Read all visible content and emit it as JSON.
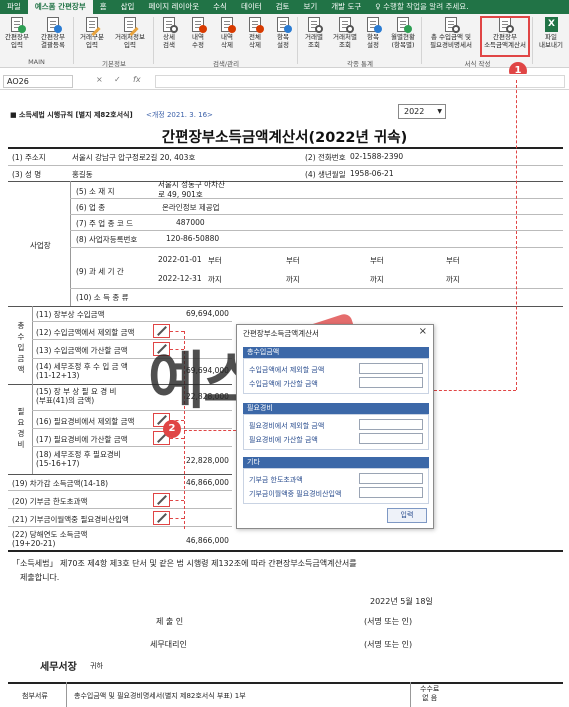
{
  "ribbon_tabs": [
    "파일",
    "예스폼 간편장부",
    "홈",
    "삽입",
    "페이지 레이아웃",
    "수식",
    "데이터",
    "검토",
    "보기",
    "개발 도구",
    "♀ 수행할 작업을 알려 주세요."
  ],
  "ribbon_buttons": [
    {
      "l1": "간편장부",
      "l2": "입력"
    },
    {
      "l1": "간편장부",
      "l2": "결괄등록"
    },
    {
      "l1": "거래구분",
      "l2": "입력"
    },
    {
      "l1": "거래처정보",
      "l2": "입력"
    },
    {
      "l1": "상세",
      "l2": "검색"
    },
    {
      "l1": "내역",
      "l2": "수정"
    },
    {
      "l1": "내역",
      "l2": "삭제"
    },
    {
      "l1": "전체",
      "l2": "삭제"
    },
    {
      "l1": "항목",
      "l2": "설정"
    },
    {
      "l1": "거래별",
      "l2": "조회"
    },
    {
      "l1": "거래처별",
      "l2": "조회"
    },
    {
      "l1": "항목",
      "l2": "설정"
    },
    {
      "l1": "월별현황",
      "l2": "(항목별)"
    },
    {
      "l1": "총 수입금액 및",
      "l2": "필요경비명세서"
    },
    {
      "l1": "간편장부",
      "l2": "소득금액계산서"
    },
    {
      "l1": "파일",
      "l2": "내보내기"
    }
  ],
  "ribbon_groups": [
    "MAIN",
    "기본정보",
    "검색/관리",
    "각종 통계",
    "서식 작성"
  ],
  "formula_bar": {
    "cell_ref": "AO26",
    "cancel": "×",
    "confirm": "✓",
    "fx": "fx"
  },
  "form": {
    "header_left": "■ 소득세법 시행규칙 [별지 제82호서식]",
    "header_rev": "<개정 2021. 3. 16>",
    "year_select": "2022",
    "title": "간편장부소득금액계산서(2022년 귀속)",
    "r1_label": "(1) 주소지",
    "r1_value": "서울시 강남구 압구정로2길 20, 403호",
    "r2_label": "(2) 전화번호",
    "r2_value": "02-1588-2390",
    "r3_label": "(3) 성 명",
    "r3_value": "홍길동",
    "r4_label": "(4) 생년월일",
    "r4_value": "1958-06-21",
    "biz_label": "사업장",
    "r5_label": "(5) 소 재 지",
    "r5_value1": "서울시 성동구 아차산",
    "r5_value2": "로 49, 901호",
    "r6_label": "(6) 업 종",
    "r6_value": "온라인정보 제공업",
    "r7_label": "(7) 주 업 종 코 드",
    "r7_value": "487000",
    "r8_label": "(8) 사업자등록번호",
    "r8_value": "120-86-50880",
    "r9_label": "(9) 과 세 기 간",
    "r9_from": "2022-01-01",
    "r9_to": "2022-12-31",
    "from_word": "부터",
    "to_word": "까지",
    "r10_label": "(10) 소 득 종 류",
    "income_side": "총수입금액",
    "r11_label": "(11) 장부상 수입금액",
    "r11_value": "69,694,000",
    "r12_label": "(12) 수입금액에서 제외할 금액",
    "r13_label": "(13) 수입금액에 가산할 금액",
    "r14_label": "(14) 세무조정 후 수 입 금 액",
    "r14_sub": "(11-12+13)",
    "r14_value": "69,694,000",
    "expense_side": "필요경비",
    "r15_label": "(15) 장 부 상 필 요 경 비",
    "r15_sub": "(부표(41)의 금액)",
    "r15_value": "22,828,000",
    "r16_label": "(16) 필요경비에서 제외할 금액",
    "r17_label": "(17) 필요경비에 가산할 금액",
    "r18_label": "(18) 세무조정 후 필요경비",
    "r18_sub": "(15-16+17)",
    "r18_value": "22,828,000",
    "r19_label": "(19) 차가감 소득금액(14-18)",
    "r19_value": "46,866,000",
    "r20_label": "(20) 기부금 한도초과액",
    "r21_label": "(21) 기부금이월액중 필요경비산입액",
    "r22_label": "(22) 당해연도 소득금액",
    "r22_sub": "(19+20-21)",
    "r22_value": "46,866,000",
    "statement1": "「소득세법」 제70조 제4항 제3호 단서 및 같은 법 시행령 제132조에 따라 간편장부소득금액계산서를",
    "statement2": "제출합니다.",
    "date": "2022년 5월 18일",
    "submitter": "제 출 인",
    "agent": "세무대리인",
    "sign1": "(서명 또는 인)",
    "sign2": "(서명 또는 인)",
    "office": "세무서장",
    "office_suffix": "귀하",
    "attach_label": "첨부서류",
    "attach_value": "총수입금액 및 필요경비명세서(별지 제82호서식 부표) 1부",
    "fee_label1": "수수료",
    "fee_label2": "없 음"
  },
  "dialog": {
    "title": "간편장부소득금액계산서",
    "close": "×",
    "sec1": "총수입금액",
    "s1_item1": "수입금액에서 제외할 금액",
    "s1_item2": "수입금액에 가산할 금액",
    "sec2": "필요경비",
    "s2_item1": "필요경비에서 제외할 금액",
    "s2_item2": "필요경비에 가산할 금액",
    "sec3": "기타",
    "s3_item1": "기부금 한도초과액",
    "s3_item2": "기부금이월액중 필요경비산입액",
    "submit": "입력"
  },
  "callouts": {
    "one": "1",
    "two": "2"
  },
  "watermark": "예스폼"
}
